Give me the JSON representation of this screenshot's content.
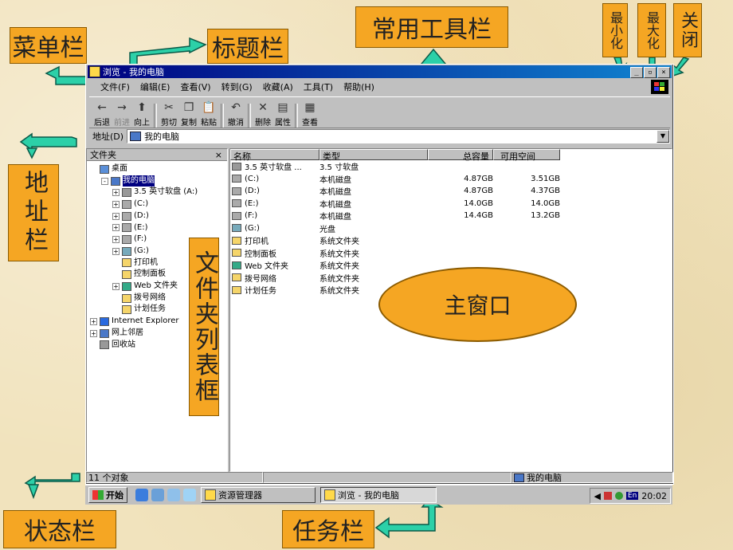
{
  "callouts": {
    "menubar": "菜单栏",
    "titlebar": "标题栏",
    "toolbar": "常用工具栏",
    "minimize": "最小化",
    "maximize": "最大化",
    "close": "关闭",
    "addressbar": "地址栏",
    "folderlist": "文件夹列表框",
    "mainwindow": "主窗口",
    "statusbar": "状态栏",
    "taskbar": "任务栏"
  },
  "window": {
    "title": "浏览 - 我的电脑",
    "buttons": {
      "minimize": "_",
      "maximize": "▫",
      "close": "×"
    },
    "menu": [
      "文件(F)",
      "编辑(E)",
      "查看(V)",
      "转到(G)",
      "收藏(A)",
      "工具(T)",
      "帮助(H)"
    ],
    "toolbar": [
      {
        "label": "后退",
        "icon": "←",
        "disabled": false
      },
      {
        "label": "前进",
        "icon": "→",
        "disabled": true
      },
      {
        "label": "向上",
        "icon": "⬆",
        "disabled": false
      },
      {
        "label": "剪切",
        "icon": "✂",
        "disabled": false
      },
      {
        "label": "复制",
        "icon": "❐",
        "disabled": false
      },
      {
        "label": "粘贴",
        "icon": "📋",
        "disabled": false
      },
      {
        "label": "撤消",
        "icon": "↶",
        "disabled": false
      },
      {
        "label": "删除",
        "icon": "✕",
        "disabled": false
      },
      {
        "label": "属性",
        "icon": "▤",
        "disabled": false
      },
      {
        "label": "查看",
        "icon": "▦",
        "disabled": false
      }
    ],
    "address": {
      "label": "地址(D)",
      "value": "我的电脑"
    },
    "folder_pane": {
      "title": "文件夹",
      "close": "×",
      "tree": [
        {
          "label": "桌面",
          "indent": 0,
          "pm": "",
          "color": "#5a8fd8"
        },
        {
          "label": "我的电脑",
          "indent": 1,
          "pm": "-",
          "color": "#4a78c8",
          "selected": true
        },
        {
          "label": "3.5 英寸软盘 (A:)",
          "indent": 2,
          "pm": "+",
          "color": "#999"
        },
        {
          "label": "(C:)",
          "indent": 2,
          "pm": "+",
          "color": "#aaa"
        },
        {
          "label": "(D:)",
          "indent": 2,
          "pm": "+",
          "color": "#aaa"
        },
        {
          "label": "(E:)",
          "indent": 2,
          "pm": "+",
          "color": "#aaa"
        },
        {
          "label": "(F:)",
          "indent": 2,
          "pm": "+",
          "color": "#aaa"
        },
        {
          "label": "(G:)",
          "indent": 2,
          "pm": "+",
          "color": "#7ab"
        },
        {
          "label": "打印机",
          "indent": 2,
          "pm": "",
          "color": "#f5d56a"
        },
        {
          "label": "控制面板",
          "indent": 2,
          "pm": "",
          "color": "#f5d56a"
        },
        {
          "label": "Web 文件夹",
          "indent": 2,
          "pm": "+",
          "color": "#3a8"
        },
        {
          "label": "拨号网络",
          "indent": 2,
          "pm": "",
          "color": "#f5d56a"
        },
        {
          "label": "计划任务",
          "indent": 2,
          "pm": "",
          "color": "#f5d56a"
        },
        {
          "label": "Internet Explorer",
          "indent": 0,
          "pm": "+",
          "color": "#2a6adf"
        },
        {
          "label": "网上邻居",
          "indent": 0,
          "pm": "+",
          "color": "#4a78c8"
        },
        {
          "label": "回收站",
          "indent": 0,
          "pm": "",
          "color": "#999"
        }
      ]
    },
    "list": {
      "columns": [
        "名称",
        "类型",
        "总容量",
        "可用空间"
      ],
      "rows": [
        {
          "name": "3.5 英寸软盘 ...",
          "type": "3.5 寸软盘",
          "total": "",
          "free": "",
          "color": "#999"
        },
        {
          "name": "(C:)",
          "type": "本机磁盘",
          "total": "4.87GB",
          "free": "3.51GB",
          "color": "#aaa"
        },
        {
          "name": "(D:)",
          "type": "本机磁盘",
          "total": "4.87GB",
          "free": "4.37GB",
          "color": "#aaa"
        },
        {
          "name": "(E:)",
          "type": "本机磁盘",
          "total": "14.0GB",
          "free": "14.0GB",
          "color": "#aaa"
        },
        {
          "name": "(F:)",
          "type": "本机磁盘",
          "total": "14.4GB",
          "free": "13.2GB",
          "color": "#aaa"
        },
        {
          "name": "(G:)",
          "type": "光盘",
          "total": "",
          "free": "",
          "color": "#7ab"
        },
        {
          "name": "打印机",
          "type": "系统文件夹",
          "total": "",
          "free": "",
          "color": "#f5d56a"
        },
        {
          "name": "控制面板",
          "type": "系统文件夹",
          "total": "",
          "free": "",
          "color": "#f5d56a"
        },
        {
          "name": "Web 文件夹",
          "type": "系统文件夹",
          "total": "",
          "free": "",
          "color": "#3a8"
        },
        {
          "name": "拨号网络",
          "type": "系统文件夹",
          "total": "",
          "free": "",
          "color": "#f5d56a"
        },
        {
          "name": "计划任务",
          "type": "系统文件夹",
          "total": "",
          "free": "",
          "color": "#f5d56a"
        }
      ]
    },
    "status": {
      "count": "11 个对象",
      "location": "我的电脑"
    }
  },
  "taskbar": {
    "start": "开始",
    "tasks": [
      "资源管理器",
      "浏览 - 我的电脑"
    ],
    "ime": "En",
    "clock": "20:02"
  }
}
